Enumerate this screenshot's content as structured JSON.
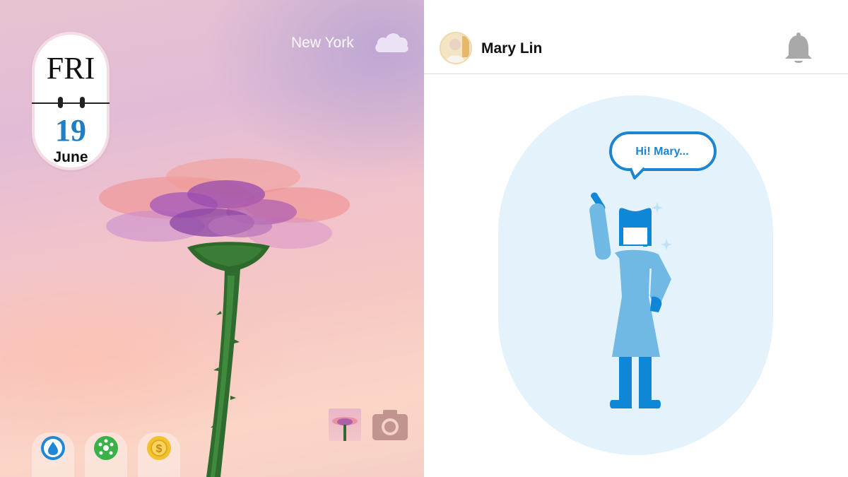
{
  "wallpaper": {
    "calendar": {
      "day": "FRI",
      "date": "19",
      "month": "June"
    },
    "weather": {
      "city": "New York",
      "icon": "cloud-icon"
    },
    "shortcuts": {
      "gallery_thumbnail": "flower-thumbnail",
      "camera": "camera-icon"
    },
    "dock": [
      {
        "icon": "water-drop-icon",
        "color": "#1f87d6"
      },
      {
        "icon": "network-icon",
        "color": "#3bb14a"
      },
      {
        "icon": "dollar-coin-icon",
        "color": "#f2c12e"
      }
    ]
  },
  "profile": {
    "name": "Mary Lin",
    "avatar": "avatar",
    "notification_icon": "bell-icon"
  },
  "greeting": {
    "message": "Hi! Mary...",
    "accent_color": "#1d84cf"
  }
}
